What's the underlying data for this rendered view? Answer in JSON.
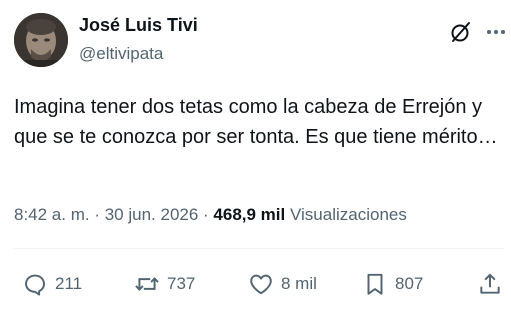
{
  "author": {
    "display_name": "José Luis Tivi",
    "handle": "@eltivipata"
  },
  "tweet": {
    "text": "Imagina tener dos tetas como la cabeza de Errejón y que se te conozca por ser tonta. Es que tiene mérito…"
  },
  "meta": {
    "time": "8:42 a. m.",
    "separator": " · ",
    "date": "30 jun. 2026",
    "views_count": "468,9 mil",
    "views_label": "Visualizaciones"
  },
  "actions": {
    "replies": "211",
    "reposts": "737",
    "likes": "8 mil",
    "bookmarks": "807"
  },
  "icons": {
    "grok": "grok-icon",
    "more": "more-icon",
    "reply": "reply-icon",
    "repost": "repost-icon",
    "like": "heart-icon",
    "bookmark": "bookmark-icon",
    "share": "share-icon"
  },
  "colors": {
    "text": "#0f1419",
    "secondary": "#536471",
    "divider": "#eff3f4"
  }
}
